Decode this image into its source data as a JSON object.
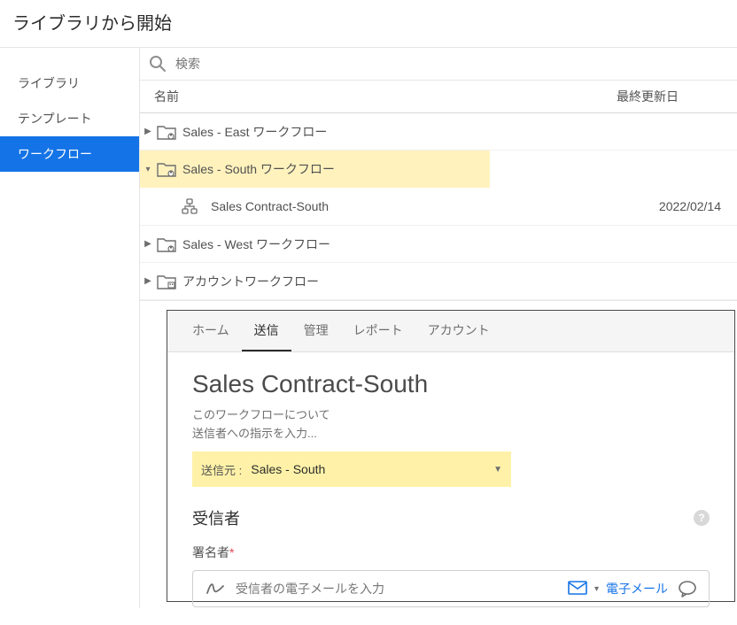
{
  "title": "ライブラリから開始",
  "sidebar": {
    "items": [
      {
        "label": "ライブラリ"
      },
      {
        "label": "テンプレート"
      },
      {
        "label": "ワークフロー"
      }
    ]
  },
  "search": {
    "placeholder": "検索"
  },
  "columns": {
    "name": "名前",
    "date": "最終更新日"
  },
  "tree": {
    "r0": {
      "label": "Sales - East ワークフロー"
    },
    "r1": {
      "label": "Sales - South ワークフロー"
    },
    "r1c": {
      "label": "Sales Contract-South",
      "date": "2022/02/14"
    },
    "r2": {
      "label": "Sales - West ワークフロー"
    },
    "r3": {
      "label": "アカウントワークフロー"
    }
  },
  "overlay": {
    "tabs": [
      {
        "label": "ホーム"
      },
      {
        "label": "送信"
      },
      {
        "label": "管理"
      },
      {
        "label": "レポート"
      },
      {
        "label": "アカウント"
      }
    ],
    "title": "Sales Contract-South",
    "about": "このワークフローについて",
    "instr": "送信者への指示を入力...",
    "send_from_label": "送信元 :",
    "send_from_value": "Sales - South",
    "recipients_title": "受信者",
    "signer_label": "署名者",
    "email_placeholder": "受信者の電子メールを入力",
    "email_text": "電子メール"
  }
}
